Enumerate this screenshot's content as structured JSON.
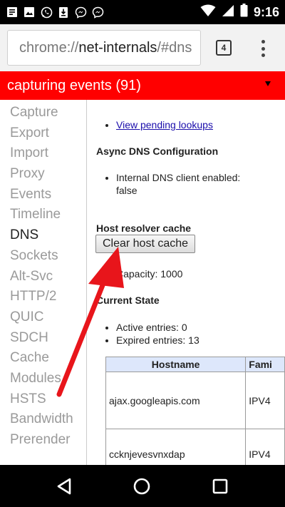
{
  "status_bar": {
    "time": "9:16",
    "left_icons": [
      "notes-icon",
      "gallery-icon",
      "whatsapp-icon",
      "download-icon",
      "messenger-icon",
      "messenger-icon"
    ],
    "right_icons": [
      "wifi-icon",
      "signal-icon",
      "battery-icon"
    ]
  },
  "browser": {
    "url_scheme": "chrome://",
    "url_host": "net-internals",
    "url_path": "/#dns",
    "tab_count": "4"
  },
  "banner": {
    "text": "capturing events (91)",
    "color": "#ff0000"
  },
  "sidebar": {
    "items": [
      {
        "label": "Capture"
      },
      {
        "label": "Export"
      },
      {
        "label": "Import"
      },
      {
        "label": "Proxy"
      },
      {
        "label": "Events"
      },
      {
        "label": "Timeline"
      },
      {
        "label": "DNS",
        "active": true
      },
      {
        "label": "Sockets"
      },
      {
        "label": "Alt-Svc"
      },
      {
        "label": "HTTP/2"
      },
      {
        "label": "QUIC"
      },
      {
        "label": "SDCH"
      },
      {
        "label": "Cache"
      },
      {
        "label": "Modules"
      },
      {
        "label": "HSTS"
      },
      {
        "label": "Bandwidth"
      },
      {
        "label": "Prerender"
      }
    ]
  },
  "main": {
    "view_pending_link": "View pending lookups",
    "async_heading": "Async DNS Configuration",
    "internal_dns_line1": "Internal DNS client enabled:",
    "internal_dns_line2": "false",
    "host_cache_heading": "Host resolver cache",
    "clear_button": "Clear host cache",
    "capacity": "Capacity: 1000",
    "current_state_heading": "Current State",
    "active_entries": "Active entries: 0",
    "expired_entries": "Expired entries: 13",
    "table": {
      "headers": [
        "Hostname",
        "Fami"
      ],
      "rows": [
        [
          "ajax.googleapis.com",
          "IPV4"
        ],
        [
          "ccknjevesvnxdap",
          "IPV4"
        ]
      ]
    }
  },
  "annotation_color": "#e8151b"
}
